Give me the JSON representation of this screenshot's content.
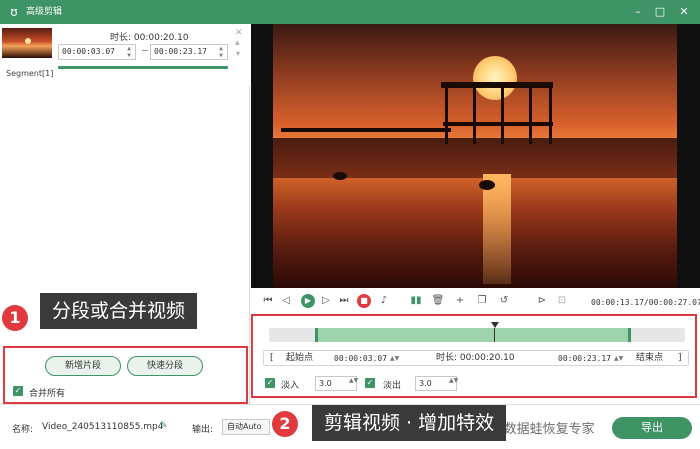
{
  "window": {
    "title": "高级剪辑",
    "logo_icon": "rabbit-logo-icon",
    "controls": [
      "minimize-icon",
      "maximize-icon",
      "close-icon"
    ],
    "accent": "#3f9466"
  },
  "segment": {
    "label": "Segment[1]",
    "duration_label": "时长: 00:00:20.10",
    "start_time": "00:00:03.07",
    "end_time": "00:00:23.17",
    "separator": "-"
  },
  "left_controls": {
    "new_segment": "新增片段",
    "quick_split": "快速分段",
    "merge_all": "合并所有",
    "merge_all_checked": true
  },
  "annotations": {
    "one": {
      "number": "1",
      "text": "分段或合并视频"
    },
    "two": {
      "number": "2",
      "text": "剪辑视频 · 增加特效"
    }
  },
  "player": {
    "time_readout": "00:00:13.17/00:00:27.07"
  },
  "edit": {
    "bracket_open": "[",
    "start_label": "起始点",
    "start_value": "00:00:03.07",
    "duration_label": "时长: 00:00:20.10",
    "end_value": "00:00:23.17",
    "end_label": "结束点",
    "bracket_close": "]",
    "fade_in_label": "淡入",
    "fade_in_value": "3.0",
    "fade_out_label": "淡出",
    "fade_out_value": "3.0",
    "fade_in_checked": true,
    "fade_out_checked": true
  },
  "bottom": {
    "name_label": "名称:",
    "file_name": "Video_240513110855.mp4",
    "output_label": "输出:",
    "output_value": "自动Auto",
    "watermark": "掘金 @ 加材 · 数据蛙恢复专家",
    "export_label": "导出"
  }
}
